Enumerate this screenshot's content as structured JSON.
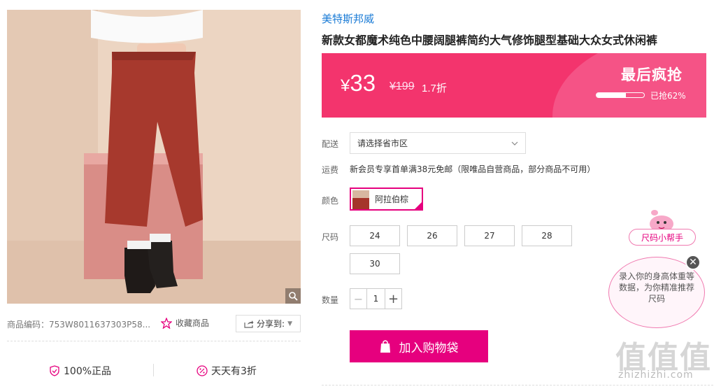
{
  "product": {
    "brand": "美特斯邦威",
    "title": "新款女都魔术纯色中腰阔腿裤简约大气修饰腿型基础大众女式休闲裤",
    "code": "商品编码：753W8011637303P58...",
    "favorite_label": "收藏商品",
    "share_label": "分享到:"
  },
  "price": {
    "currency": "¥",
    "current": "33",
    "original": "¥199",
    "discount": "1.7折",
    "flash_label": "最后疯抢",
    "sold_text": "已抢62%",
    "sold_fraction": 0.62
  },
  "delivery": {
    "label": "配送",
    "region_placeholder": "请选择省市区"
  },
  "shipping": {
    "label": "运费",
    "text": "新会员专享首单满38元免邮（限唯品自营商品，部分商品不可用）"
  },
  "colors": {
    "label": "颜色",
    "selected": "阿拉伯棕"
  },
  "sizes": {
    "label": "尺码",
    "options": [
      "24",
      "26",
      "27",
      "28",
      "30"
    ]
  },
  "quantity": {
    "label": "数量",
    "value": "1"
  },
  "cart_button": "加入购物袋",
  "assurance": {
    "authentic": "100%正品",
    "daily_discount": "天天有3折"
  },
  "size_helper": {
    "button": "尺码小帮手",
    "bubble_text": "录入你的身高体重等数据，为你精准推荐尺码"
  },
  "watermark": {
    "text": "值值值",
    "url": "zhizhizhi.com"
  },
  "colors_hex": {
    "accent": "#e6007e",
    "price_banner": "#f3346d",
    "brand_link": "#1a7bd6"
  }
}
